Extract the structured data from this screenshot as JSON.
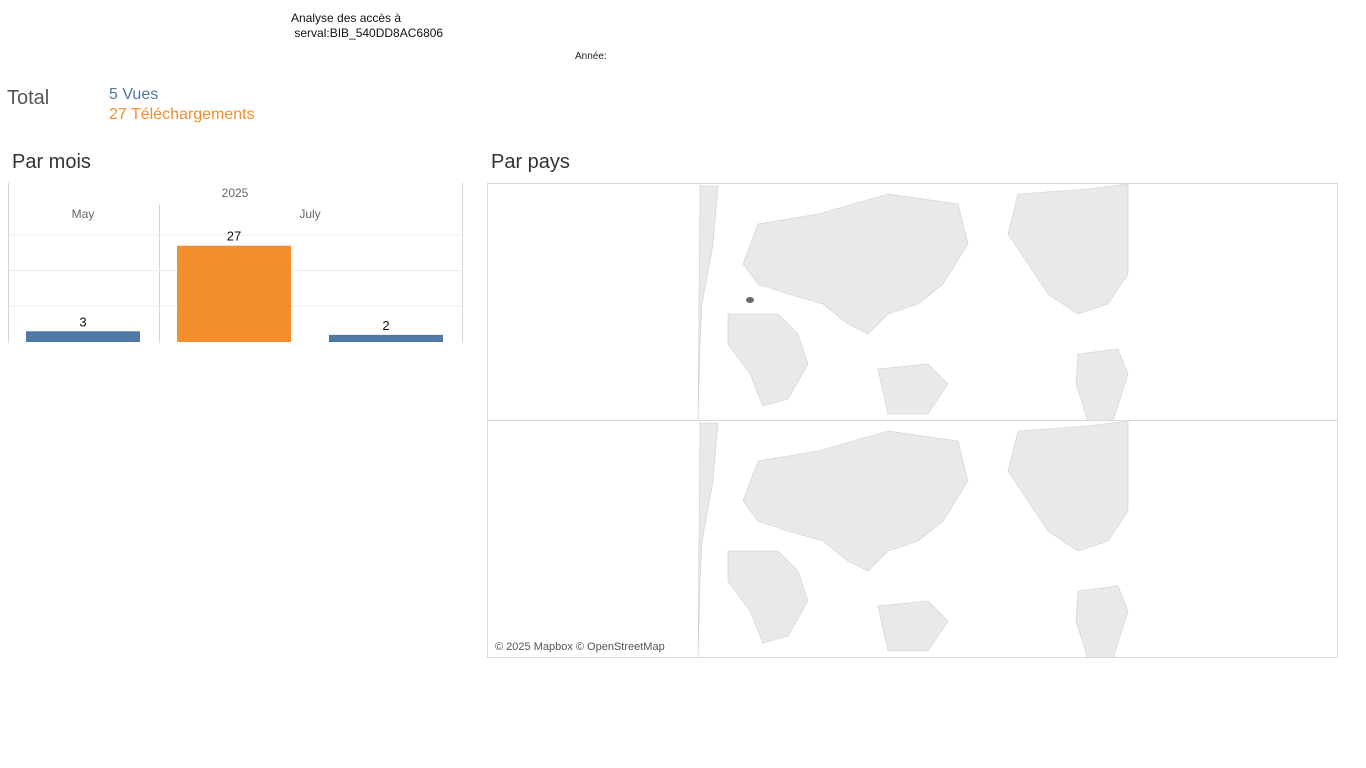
{
  "header": {
    "title_line1": "Analyse des accès à",
    "title_line2": "serval:BIB_540DD8AC6806",
    "year_label": "Année:"
  },
  "totals": {
    "label": "Total",
    "views": "5 Vues",
    "downloads": "27 Téléchargements",
    "views_color": "#4e79a7",
    "downloads_color": "#f28e2b"
  },
  "sections": {
    "by_month": "Par mois",
    "by_country": "Par pays"
  },
  "chart_data": {
    "type": "bar",
    "year": "2025",
    "months": [
      "May",
      "July"
    ],
    "bars": [
      {
        "month": "May",
        "series": "Vues",
        "value": 3,
        "color": "#4e79a7"
      },
      {
        "month": "July",
        "series": "Téléchargements",
        "value": 27,
        "color": "#f28e2b"
      },
      {
        "month": "July",
        "series": "Vues",
        "value": 2,
        "color": "#4e79a7"
      }
    ],
    "ylim": [
      0,
      30
    ],
    "grid": true
  },
  "map": {
    "attribution": "© 2025 Mapbox © OpenStreetMap",
    "highlighted_country": "Switzerland",
    "highlight_color": "#6a6a6a"
  }
}
